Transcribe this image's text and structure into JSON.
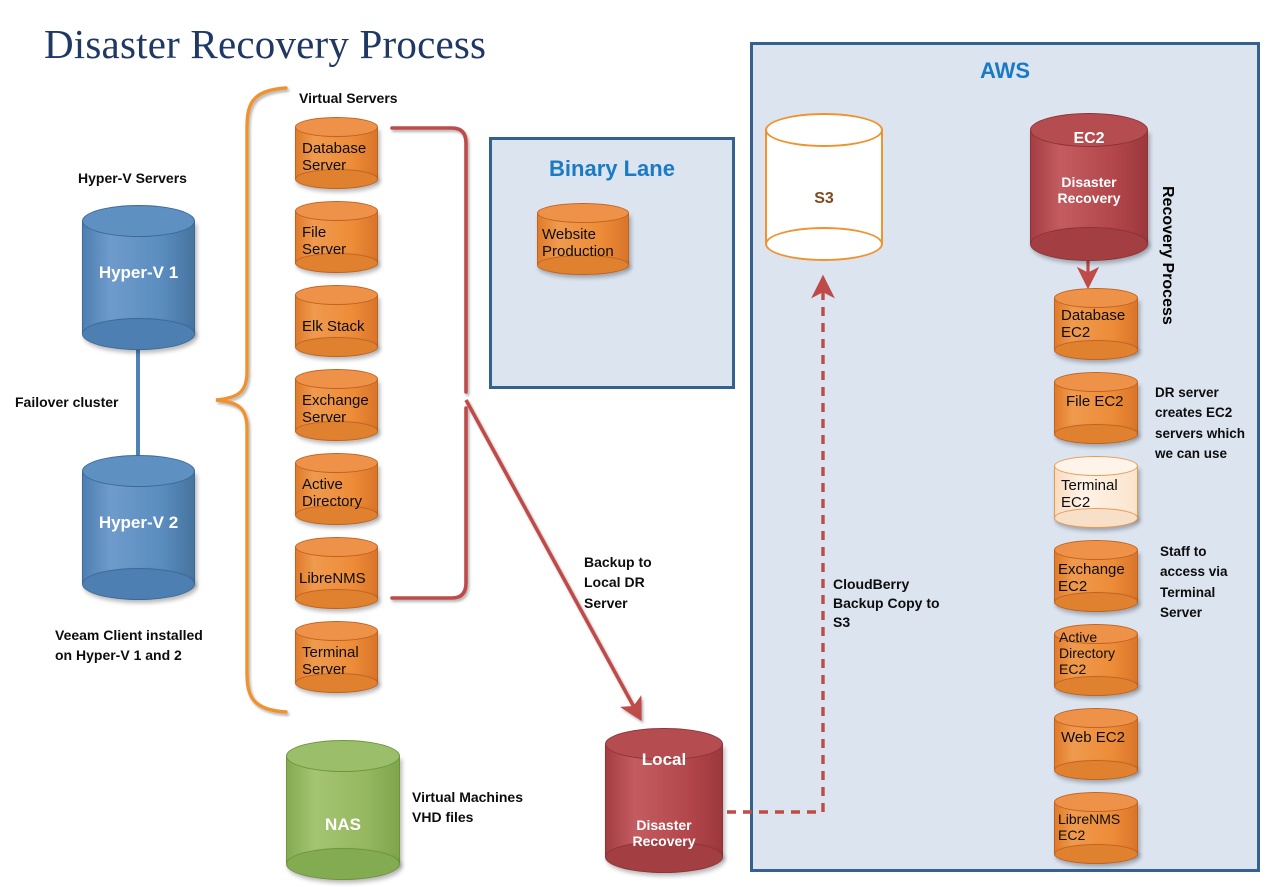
{
  "page": {
    "title": "Disaster Recovery Process"
  },
  "regions": {
    "binary_lane": {
      "title": "Binary Lane"
    },
    "aws": {
      "title": "AWS",
      "side_label": "Recovery Process"
    }
  },
  "hyperv": {
    "heading": "Hyper-V Servers",
    "nodes": [
      {
        "label": "Hyper-V 1"
      },
      {
        "label": "Hyper-V 2"
      }
    ],
    "cluster_label": "Failover cluster",
    "veeam_note": "Veeam Client installed on Hyper-V 1 and 2"
  },
  "virtual_servers": {
    "heading": "Virtual Servers",
    "nodes": [
      {
        "label": "Database Server"
      },
      {
        "label": "File Server"
      },
      {
        "label": "Elk Stack"
      },
      {
        "label": "Exchange Server"
      },
      {
        "label": "Active Directory"
      },
      {
        "label": "LibreNMS"
      },
      {
        "label": "Terminal Server"
      }
    ]
  },
  "binary_lane_nodes": [
    {
      "label": "Website Production"
    }
  ],
  "nas": {
    "label": "NAS",
    "note": "Virtual Machines VHD files"
  },
  "local_dr": {
    "title": "Local",
    "subtitle": "Disaster Recovery"
  },
  "aws_nodes": {
    "s3": {
      "label": "S3"
    },
    "ec2_main": {
      "title": "EC2",
      "subtitle": "Disaster Recovery"
    },
    "ec2_list": [
      {
        "label": "Database EC2"
      },
      {
        "label": "File EC2"
      },
      {
        "label": "Terminal EC2"
      },
      {
        "label": "Exchange EC2"
      },
      {
        "label": "Active Directory EC2"
      },
      {
        "label": "Web EC2"
      },
      {
        "label": "LibreNMS EC2"
      }
    ]
  },
  "annotations": {
    "backup_local": "Backup to Local DR Server",
    "cloudberry": "CloudBerry Backup Copy to S3",
    "dr_creates": "DR server creates EC2 servers which we can use",
    "staff_access": "Staff to access via Terminal Server"
  },
  "colors": {
    "title": "#1F3864",
    "region_border": "#35618F",
    "region_fill": "#DCE4F0",
    "region_title": "#1A7BC4",
    "orange": "#ED8C38",
    "blue": "#5B8DC0",
    "red": "#B3474B",
    "green": "#95B861",
    "brace": "#F0922E",
    "connector": "#BE4B48"
  }
}
